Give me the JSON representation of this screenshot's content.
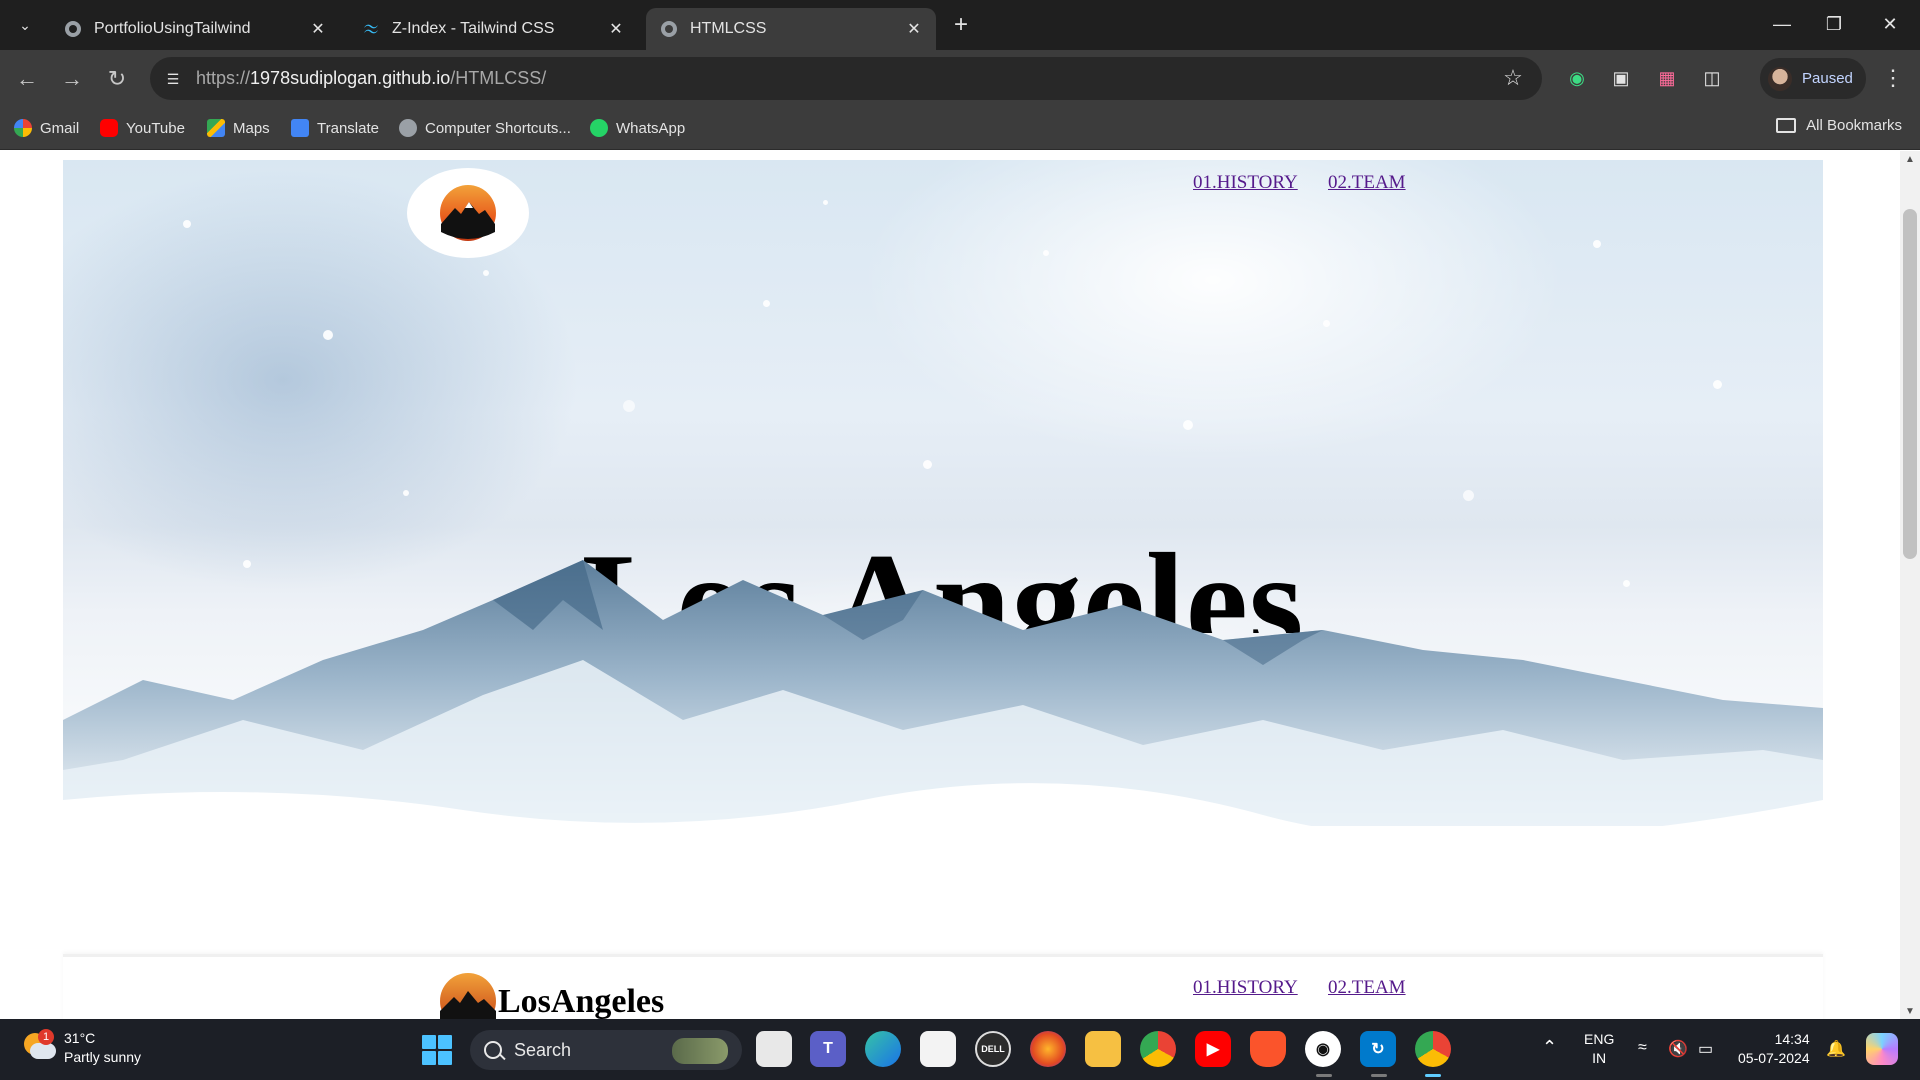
{
  "browser": {
    "tabs": [
      {
        "title": "PortfolioUsingTailwind",
        "icon": "globe-icon",
        "active": false
      },
      {
        "title": "Z-Index - Tailwind CSS",
        "icon": "tailwind-icon",
        "active": false
      },
      {
        "title": "HTMLCSS",
        "icon": "globe-icon",
        "active": true
      }
    ],
    "url_prefix": "https://",
    "url_host": "1978sudiplogan.github.io",
    "url_path": "/HTMLCSS/",
    "profile_status": "Paused",
    "bookmarks": [
      {
        "label": "Gmail",
        "icon": "google-icon",
        "color": "#4285f4"
      },
      {
        "label": "YouTube",
        "icon": "youtube-icon",
        "color": "#ff0000"
      },
      {
        "label": "Maps",
        "icon": "maps-icon",
        "color": "#34a853"
      },
      {
        "label": "Translate",
        "icon": "translate-icon",
        "color": "#4285f4"
      },
      {
        "label": "Computer Shortcuts...",
        "icon": "globe-icon",
        "color": "#9aa0a6"
      },
      {
        "label": "WhatsApp",
        "icon": "whatsapp-icon",
        "color": "#25d366"
      }
    ],
    "all_bookmarks": "All Bookmarks"
  },
  "page": {
    "hero_title": "Los Angeles",
    "nav": {
      "history": "01.HISTORY",
      "team": "02.TEAM"
    },
    "section2": {
      "brand": "LosAngeles",
      "nav": {
        "history": "01.HISTORY",
        "team": "02.TEAM"
      }
    },
    "link_color": "#551a8b"
  },
  "taskbar": {
    "weather_temp": "31°C",
    "weather_desc": "Partly sunny",
    "weather_badge": "1",
    "search_label": "Search",
    "lang_line1": "ENG",
    "lang_line2": "IN",
    "time": "14:34",
    "date": "05-07-2024"
  }
}
